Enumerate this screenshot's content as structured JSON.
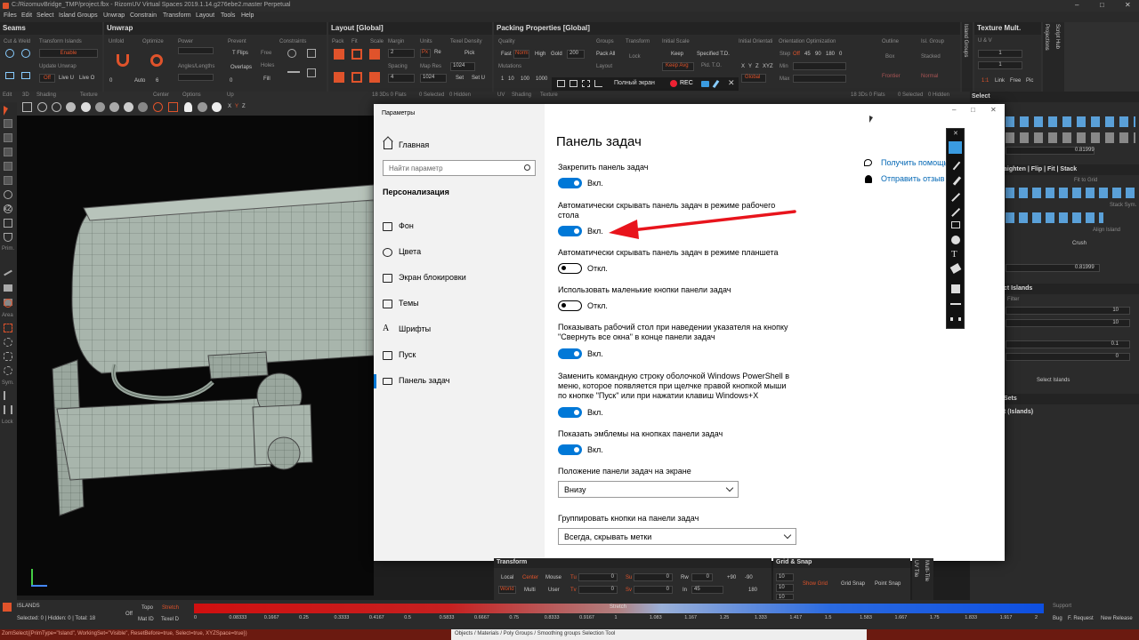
{
  "app": {
    "title": "C:/RizomuvBridge_TMP/project.fbx - RizomUV  Virtual Spaces 2019.1.14.g276ebe2.master Perpetual",
    "menu": [
      "Files",
      "Edit",
      "Select",
      "Island Groups",
      "Unwrap",
      "Constrain",
      "Transform",
      "Layout",
      "Tools",
      "Help"
    ]
  },
  "panels": {
    "seams": {
      "title": "Seams",
      "cut_weld": "Cut & Weld",
      "transform_islands": "Transform Islands",
      "enable": "Enable",
      "update_unwrap": "Update Unwrap",
      "off": "Off",
      "live_u": "Live U",
      "live_o": "Live O"
    },
    "unwrap": {
      "title": "Unwrap",
      "unfold": "Unfold",
      "optimize": "Optimize",
      "power": "Power",
      "prevent": "Prevent",
      "constraints": "Constraints",
      "t_flips": "T Flips",
      "free": "Free",
      "angles_lengths": "Angles/Lengths",
      "overlaps": "Overlaps",
      "holes": "Holes",
      "fill": "Fill",
      "auto": "Auto",
      "v0": "0",
      "v6": "6",
      "v0b": "0"
    },
    "layout": {
      "title": "Layout [Global]",
      "pack": "Pack",
      "fit": "Fit",
      "scale": "Scale",
      "margin": "Margin",
      "units": "Units",
      "texel_density": "Texel Density",
      "spacing": "Spacing",
      "map_res": "Map Res",
      "m2": "2",
      "s4": "4",
      "mr1": "1024",
      "mr2": "1024",
      "px": "Px",
      "re": "Re",
      "pick": "Pick",
      "set": "Set",
      "set_u": "Set U"
    },
    "packing": {
      "title": "Packing Properties [Global]",
      "quality": "Quality",
      "fast": "Fast",
      "norm": "Norm",
      "high": "High",
      "gold": "Gold",
      "q200": "200",
      "mutations": "Mutations",
      "m1": "1",
      "m10": "10",
      "m100": "100",
      "m1000": "1000",
      "groups": "Groups",
      "pack_all": "Pack All",
      "layout": "Layout",
      "transform": "Transform",
      "lock": "Lock",
      "initial_scale": "Initial Scale",
      "keep": "Keep",
      "specified_td": "Specified T.D.",
      "keep_avg": "Keep Avg",
      "pid_to": "Pid. T.O.",
      "initial_orientation": "Initial Orientati",
      "orientation_optimization": "Orientation Optimization",
      "x": "X",
      "y": "Y",
      "z": "Z",
      "xyz": "XYZ",
      "step": "Step",
      "off": "Off",
      "s45": "45",
      "s90": "90",
      "s180": "180",
      "s0": "0",
      "min": "Min",
      "max": "Max",
      "global": "Global",
      "outline": "Outline",
      "box": "Box",
      "frontier": "Frontier",
      "isl_group": "Isl. Group",
      "stacked": "Stacked",
      "normal": "Normal"
    },
    "texture": {
      "title": "Texture Mult.",
      "uv": "U & V",
      "t1": "1",
      "t2": "1",
      "one": "1:1",
      "link": "Link",
      "free": "Free",
      "pic": "Pic"
    },
    "vertical_tabs": {
      "island_groups": "Island Groups",
      "projections": "Projections",
      "script_hub": "Script Hub"
    }
  },
  "viewport": {
    "edit": "Edit",
    "d3": "3D",
    "shading": "Shading",
    "texture": "Texture",
    "center": "Center",
    "options": "Options",
    "up": "Up",
    "stats": "18 3Ds 0 Flats",
    "selected": "0 Selected",
    "hidden": "0 Hidden",
    "uv": "UV",
    "uv_shading": "Shading",
    "uv_texture": "Texture",
    "side_labels": [
      "x2",
      "Prim.",
      "Area",
      "Sym.",
      "Lock"
    ]
  },
  "capture_bar": {
    "fullscreen": "Полный экран",
    "rec": "REC"
  },
  "settings": {
    "window_title": "Параметры",
    "home": "Главная",
    "search_placeholder": "Найти параметр",
    "section": "Персонализация",
    "nav": [
      "Фон",
      "Цвета",
      "Экран блокировки",
      "Темы",
      "Шрифты",
      "Пуск",
      "Панель задач"
    ],
    "page_title": "Панель задач",
    "options": [
      {
        "label": "Закрепить панель задач",
        "state": "Вкл.",
        "on": true
      },
      {
        "label": "Автоматически скрывать панель задач в режиме рабочего стола",
        "state": "Вкл.",
        "on": true
      },
      {
        "label": "Автоматически скрывать панель задач в режиме планшета",
        "state": "Откл.",
        "on": false
      },
      {
        "label": "Использовать маленькие кнопки панели задач",
        "state": "Откл.",
        "on": false
      },
      {
        "label": "Показывать рабочий стол при наведении указателя на кнопку \"Свернуть все окна\" в конце панели задач",
        "state": "Вкл.",
        "on": true
      },
      {
        "label": "Заменить командную строку оболочкой Windows PowerShell в меню, которое появляется при щелчке правой кнопкой мыши по кнопке \"Пуск\" или при нажатии клавиш Windows+X",
        "state": "Вкл.",
        "on": true
      },
      {
        "label": "Показать эмблемы на кнопках панели задач",
        "state": "Вкл.",
        "on": true
      }
    ],
    "option_lines": {
      "o1a": "Автоматически скрывать панель задач в режиме рабочего",
      "o1b": "стола",
      "o4a": "Показывать рабочий стол при наведении указателя на кнопку",
      "o4b": "\"Свернуть все окна\" в конце панели задач",
      "o5a": "Заменить командную строку оболочкой Windows PowerShell в",
      "o5b": "меню, которое появляется при щелчке правой кнопкой мыши",
      "o5c": "по кнопке \"Пуск\" или при нажатии клавиш Windows+X"
    },
    "position_label": "Положение панели задач на экране",
    "position_value": "Внизу",
    "group_label": "Группировать кнопки на панели задач",
    "group_value": "Всегда, скрывать метки",
    "help": "Получить помощь",
    "feedback": "Отправить отзыв"
  },
  "right_panel": {
    "select": "Select",
    "value1": "0.81999",
    "value2": "0.81999",
    "straighten": "aighten | Flip | Fit | Stack",
    "fit_to_grid": "Fit to Grid",
    "stack_sym": "Stack Sym.",
    "align_island": "Align Island",
    "crush": "Crush",
    "select_islands": "ct Islands",
    "filter": "Filter",
    "v10a": "10",
    "v10b": "10",
    "v01": "0.1",
    "v0a": "0",
    "v0b": "0",
    "select_islands_btn": "Select Islands",
    "sets": "Sets",
    "sets_item": "t (Islands)"
  },
  "bottom": {
    "transform": "Transform",
    "local": "Local",
    "center": "Center",
    "mouse": "Mouse",
    "world": "World",
    "multi": "Multi",
    "user": "User",
    "tu": "Tu",
    "tv": "Tv",
    "su": "Su",
    "sv": "Sv",
    "rw": "Rw",
    "in": "In",
    "rv1": "+90",
    "rv2": "-90",
    "rv3": "45",
    "rv4": "180",
    "zero": "0",
    "grid_snap": "Grid & Snap",
    "g10a": "10",
    "g10b": "10",
    "g10c": "10",
    "show_grid": "Show Grid",
    "grid_snap_btn": "Grid Snap",
    "point_snap": "Point Snap",
    "uv_tile": "UV Tile",
    "multi_tile": "Multi-Tile",
    "islands": "ISLANDS",
    "counts": "Selected: 0 | Hidden: 0 | Total: 18",
    "off": "Off",
    "topo": "Topo",
    "stretch": "Stretch",
    "mat_id": "Mat ID",
    "texel_d": "Texel D",
    "stretch_label": "Stretch",
    "scale_ticks": [
      "0",
      "0.08333",
      "0.1667",
      "0.25",
      "0.3333",
      "0.4167",
      "0.5",
      "0.5833",
      "0.6667",
      "0.75",
      "0.8333",
      "0.9167",
      "1",
      "1.083",
      "1.167",
      "1.25",
      "1.333",
      "1.417",
      "1.5",
      "1.583",
      "1.667",
      "1.75",
      "1.833",
      "1.917",
      "2"
    ],
    "support": "Support",
    "bug": "Bug",
    "f_request": "F. Request",
    "new_release": "New Release",
    "command": "ZomSelect({PrimType=\"Island\", WorkingSet=\"Visible\", ResetBefore=true, Select=true, XYZSpace=true})",
    "status": "Objects / Materials / Poly Groups / Smoothing groups Selection Tool"
  },
  "colors": {
    "accent": "#e0532b",
    "toggle_on": "#0078d7",
    "arrow": "#e8141c",
    "mesh": "#a8b5ac"
  }
}
